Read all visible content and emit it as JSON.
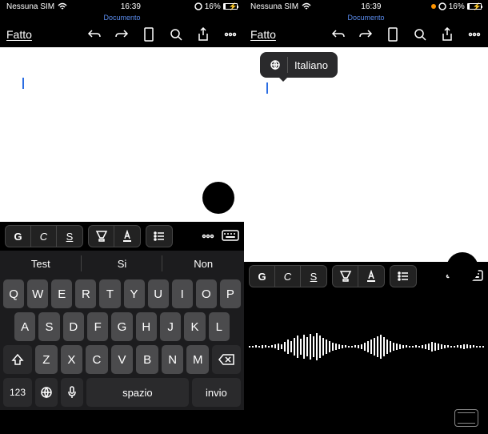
{
  "status": {
    "carrier": "Nessuna SIM",
    "time": "16:39",
    "battery_pct": "16%"
  },
  "doc_label": "Documento",
  "toolbar": {
    "done": "Fatto"
  },
  "tooltip": {
    "language": "Italiano"
  },
  "format": {
    "bold": "G",
    "italic": "C",
    "underline": "S"
  },
  "suggestions": [
    "Test",
    "Si",
    "Non"
  ],
  "keyboard": {
    "row1": [
      "Q",
      "W",
      "E",
      "R",
      "T",
      "Y",
      "U",
      "I",
      "O",
      "P"
    ],
    "row2": [
      "A",
      "S",
      "D",
      "F",
      "G",
      "H",
      "J",
      "K",
      "L"
    ],
    "row3": [
      "Z",
      "X",
      "C",
      "V",
      "B",
      "N",
      "M"
    ],
    "numkey": "123",
    "space": "spazio",
    "enter": "invio"
  }
}
